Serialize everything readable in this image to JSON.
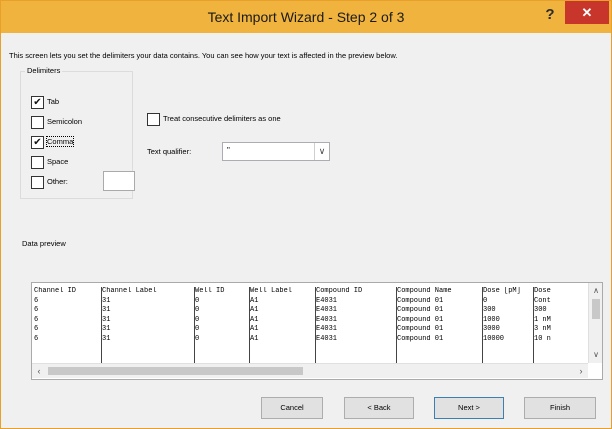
{
  "window": {
    "title": "Text Import Wizard - Step 2 of 3",
    "help_label": "?",
    "close_label": "✕",
    "accent_color": "#f0b33e",
    "close_color": "#c7352b"
  },
  "description": "This screen lets you set the delimiters your data contains.  You can see how your text is affected in the preview below.",
  "delimiters": {
    "group_label": "Delimiters",
    "tab": {
      "label": "Tab",
      "checked": true
    },
    "semicolon": {
      "label": "Semicolon",
      "checked": false
    },
    "comma": {
      "label": "Comma",
      "checked": true
    },
    "space": {
      "label": "Space",
      "checked": false
    },
    "other": {
      "label": "Other:",
      "checked": false,
      "value": ""
    }
  },
  "consecutive": {
    "label": "Treat consecutive delimiters as one",
    "checked": false
  },
  "qualifier": {
    "label": "Text qualifier:",
    "value": "\""
  },
  "preview": {
    "group_label": "Data preview",
    "headers": [
      "Channel ID",
      "Channel Label",
      "Well ID",
      "Well Label",
      "Compound ID",
      "Compound Name",
      "Dose [pM]",
      "Dose"
    ],
    "rows": [
      [
        "6",
        "31",
        "0",
        "A1",
        "E4031",
        "Compound 01",
        "0",
        "Cont"
      ],
      [
        "6",
        "31",
        "0",
        "A1",
        "E4031",
        "Compound 01",
        "300",
        "300"
      ],
      [
        "6",
        "31",
        "0",
        "A1",
        "E4031",
        "Compound 01",
        "1000",
        "1 nM"
      ],
      [
        "6",
        "31",
        "0",
        "A1",
        "E4031",
        "Compound 01",
        "3000",
        "3 nM"
      ],
      [
        "6",
        "31",
        "0",
        "A1",
        "E4031",
        "Compound 01",
        "10000",
        "10 n"
      ]
    ]
  },
  "buttons": {
    "cancel": "Cancel",
    "back": "< Back",
    "next": "Next >",
    "finish": "Finish"
  }
}
